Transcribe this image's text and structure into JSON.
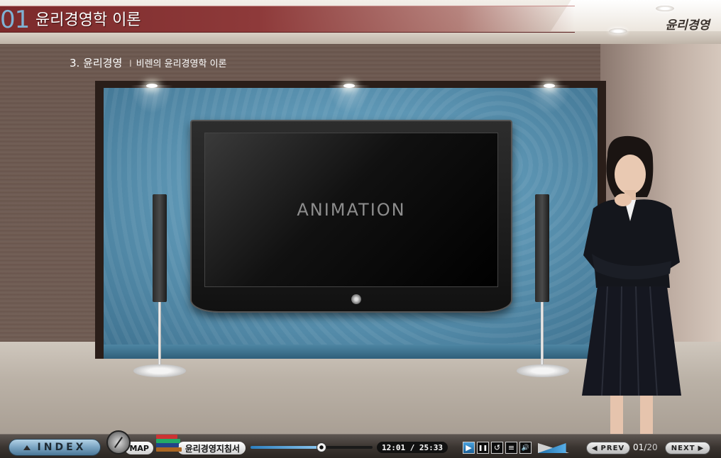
{
  "header": {
    "chapter_number": "01",
    "chapter_title": "윤리경영학 이론",
    "brand": "윤리경영"
  },
  "subheader": {
    "section": "3. 윤리경영",
    "separator": "l",
    "topic": "비렌의 윤리경영학 이론"
  },
  "stage": {
    "screen_text": "ANIMATION"
  },
  "controls": {
    "index_label": "INDEX",
    "map_label": "MAP",
    "guide_label": "윤리경영지침서",
    "time_display": "12:01 / 25:33",
    "progress": 0.58,
    "volume_level": 0.9,
    "prev_label": "PREV",
    "next_label": "NEXT",
    "page_current": "01",
    "page_separator": "/",
    "page_total": "20",
    "buttons": [
      {
        "name": "play-button",
        "glyph": "▶"
      },
      {
        "name": "pause-button",
        "glyph": "❚❚"
      },
      {
        "name": "replay-button",
        "glyph": "↺"
      },
      {
        "name": "menu-button",
        "glyph": "≡"
      },
      {
        "name": "sound-button",
        "glyph": "🔊"
      }
    ]
  },
  "colors": {
    "title_bar": "#8e3a3a",
    "chapter_number": "#7fb1d3",
    "accent_blue": "#4c7898",
    "progress_fill": "#2d7fbf"
  }
}
